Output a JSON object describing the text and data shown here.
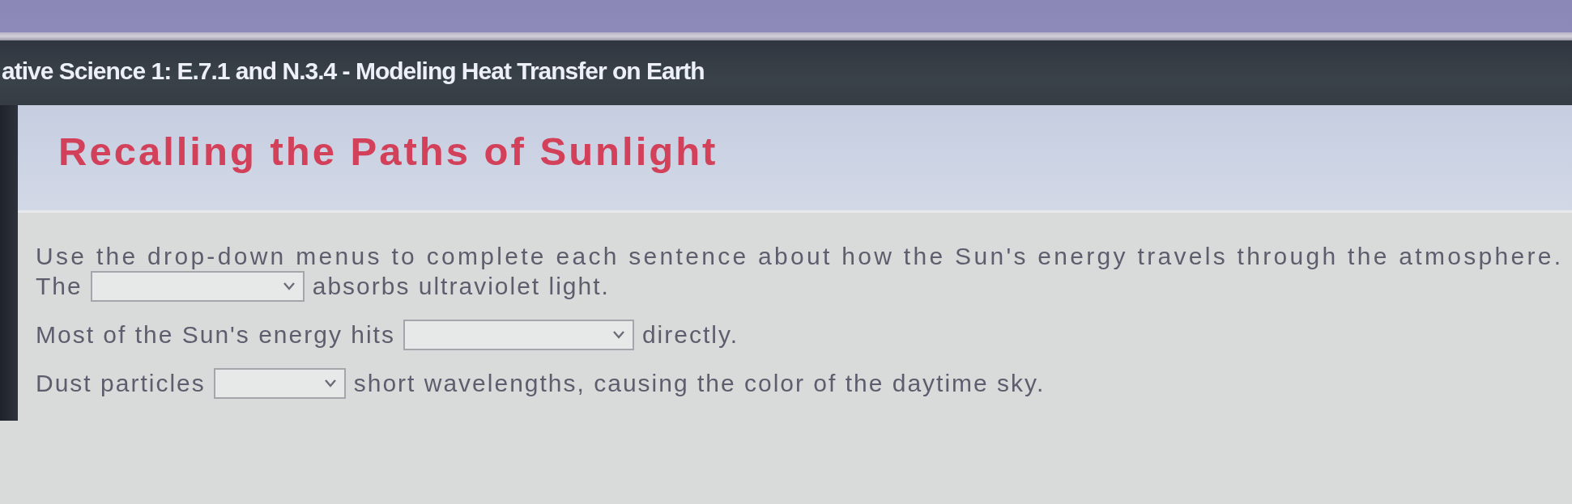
{
  "course_bar": {
    "title": "ative Science 1: E.7.1 and N.3.4 - Modeling Heat Transfer on Earth"
  },
  "header": {
    "title": "Recalling the Paths of Sunlight"
  },
  "instructions": "Use the drop-down menus to complete each sentence about how the Sun's energy travels through the atmosphere.",
  "sentences": [
    {
      "before": "The",
      "after": "absorbs ultraviolet light."
    },
    {
      "before": "Most of the Sun's energy hits",
      "after": "directly."
    },
    {
      "before": "Dust particles",
      "after": "short wavelengths, causing the color of the daytime sky."
    }
  ]
}
